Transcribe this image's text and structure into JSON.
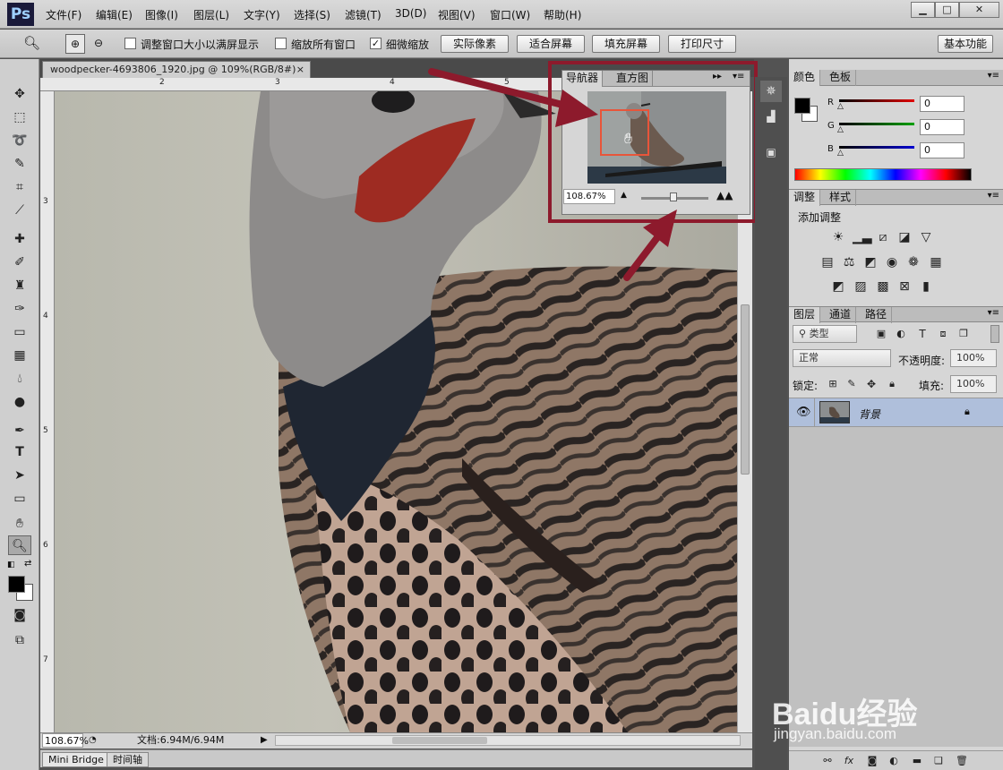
{
  "app": {
    "logo": "Ps"
  },
  "menu": [
    "文件(F)",
    "编辑(E)",
    "图像(I)",
    "图层(L)",
    "文字(Y)",
    "选择(S)",
    "滤镜(T)",
    "3D(D)",
    "视图(V)",
    "窗口(W)",
    "帮助(H)"
  ],
  "window_controls": {
    "minimize": "▁",
    "maximize": "□",
    "close": "✕"
  },
  "options": {
    "resize_windows_label": "调整窗口大小以满屏显示",
    "resize_windows_checked": false,
    "zoom_all_label": "缩放所有窗口",
    "zoom_all_checked": false,
    "scrubby_zoom_label": "细微缩放",
    "scrubby_zoom_checked": true,
    "actual_pixels": "实际像素",
    "fit_screen": "适合屏幕",
    "fill_screen": "填充屏幕",
    "print_size": "打印尺寸",
    "workspace": "基本功能"
  },
  "document": {
    "tab_title": "woodpecker-4693806_1920.jpg @ 109%(RGB/8#)",
    "close": "×",
    "ruler_top": [
      "2",
      "3",
      "4",
      "5"
    ],
    "ruler_left": [
      "3",
      "4",
      "5",
      "6",
      "7"
    ],
    "zoom_status": "108.67%",
    "doc_size": "文档:6.94M/6.94M"
  },
  "bottom_tabs": [
    "Mini Bridge",
    "时间轴"
  ],
  "navigator": {
    "tabs": [
      "导航器",
      "直方图"
    ],
    "zoom": "108.67%"
  },
  "color_panel": {
    "tabs": [
      "颜色",
      "色板"
    ],
    "channels": [
      {
        "label": "R",
        "value": "0",
        "color": "#e00000"
      },
      {
        "label": "G",
        "value": "0",
        "color": "#00a000"
      },
      {
        "label": "B",
        "value": "0",
        "color": "#0000d0"
      }
    ]
  },
  "adjustments_panel": {
    "tabs": [
      "调整",
      "样式"
    ],
    "title": "添加调整"
  },
  "layers_panel": {
    "tabs": [
      "图层",
      "通道",
      "路径"
    ],
    "filter_kind": "类型",
    "blend_mode": "正常",
    "opacity_label": "不透明度:",
    "opacity_value": "100%",
    "lock_label": "锁定:",
    "fill_label": "填充:",
    "fill_value": "100%",
    "layers": [
      {
        "name": "背景",
        "locked": true,
        "visible": true
      }
    ]
  },
  "watermark": {
    "brand": "Baidu经验",
    "url": "jingyan.baidu.com"
  }
}
